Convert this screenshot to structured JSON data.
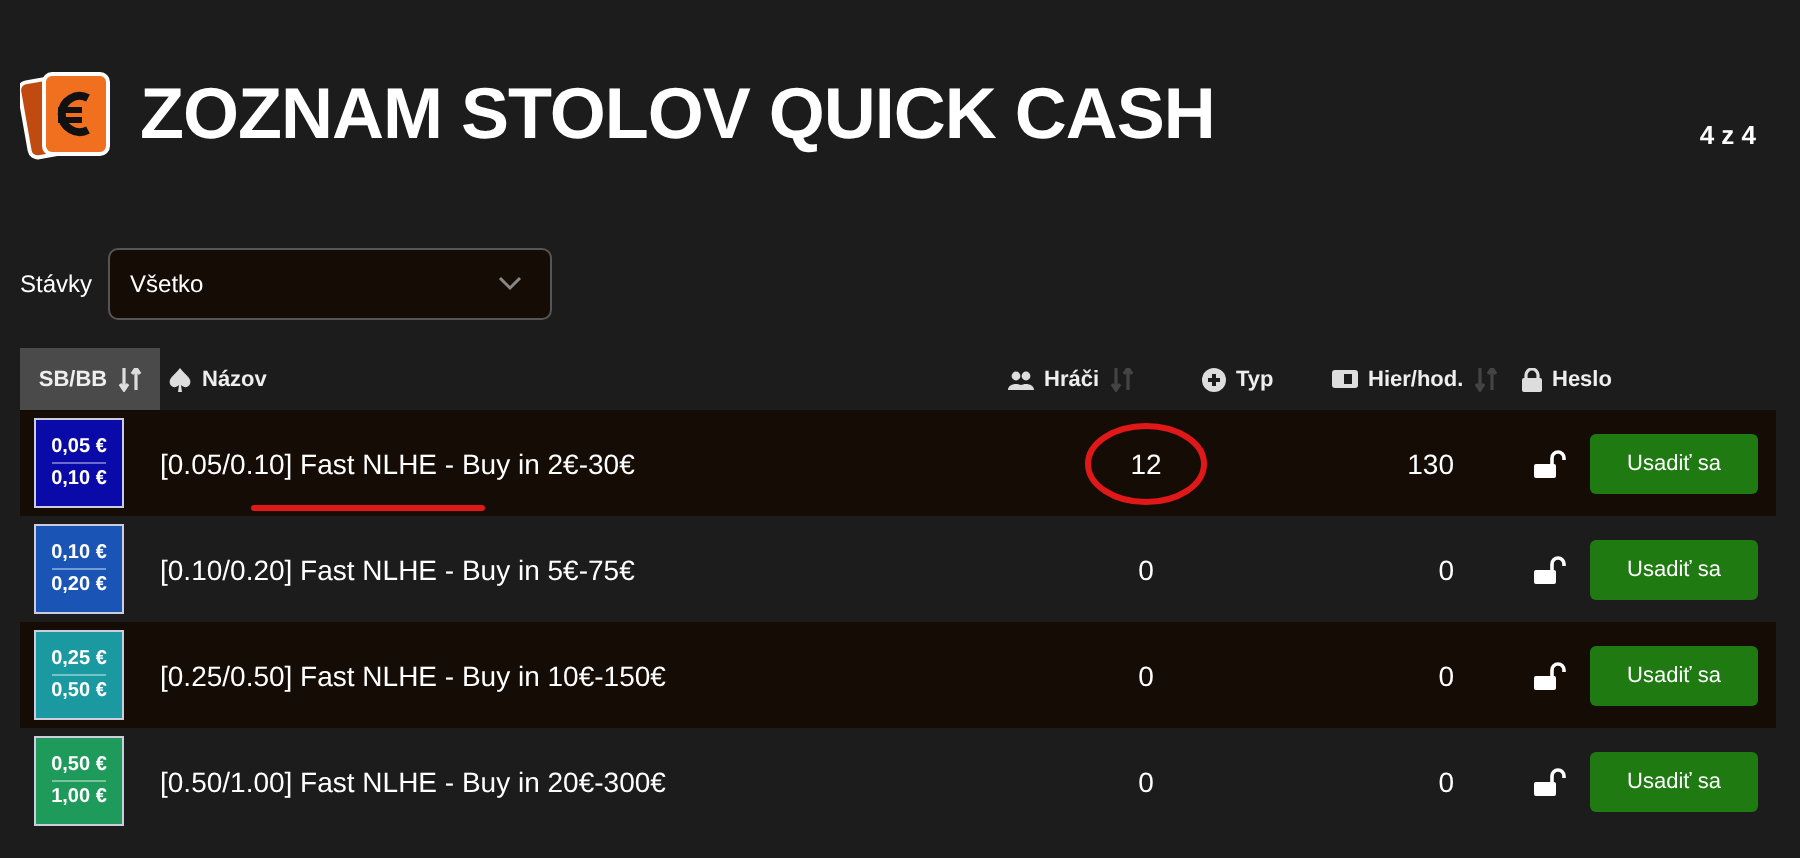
{
  "title": "ZOZNAM STOLOV QUICK CASH",
  "page_count": "4 z 4",
  "filter": {
    "label": "Stávky",
    "value": "Všetko"
  },
  "columns": [
    {
      "label": "SB/BB",
      "sortable": true,
      "selected": true
    },
    {
      "label": "Názov",
      "sortable": false,
      "selected": false
    },
    {
      "label": "Hráči",
      "sortable": true,
      "selected": false
    },
    {
      "label": "Typ",
      "sortable": false,
      "selected": false
    },
    {
      "label": "Hier/hod.",
      "sortable": true,
      "selected": false
    },
    {
      "label": "Heslo",
      "sortable": false,
      "selected": false
    }
  ],
  "rows": [
    {
      "sb": "0,05 €",
      "bb": "0,10 €",
      "color": "#0a0aa8",
      "name": "[0.05/0.10] Fast NLHE - Buy in 2€-30€",
      "players": "12",
      "hands": "130",
      "locked": false,
      "marked": true,
      "action": "Usadiť sa"
    },
    {
      "sb": "0,10 €",
      "bb": "0,20 €",
      "color": "#1a55b5",
      "name": "[0.10/0.20] Fast NLHE - Buy in 5€-75€",
      "players": "0",
      "hands": "0",
      "locked": false,
      "action": "Usadiť sa"
    },
    {
      "sb": "0,25 €",
      "bb": "0,50 €",
      "color": "#1a9aa0",
      "name": "[0.25/0.50] Fast NLHE - Buy in 10€-150€",
      "players": "0",
      "hands": "0",
      "locked": false,
      "action": "Usadiť sa"
    },
    {
      "sb": "0,50 €",
      "bb": "1,00 €",
      "color": "#1e9a5a",
      "name": "[0.50/1.00] Fast NLHE - Buy in 20€-300€",
      "players": "0",
      "hands": "0",
      "locked": false,
      "action": "Usadiť sa"
    }
  ]
}
